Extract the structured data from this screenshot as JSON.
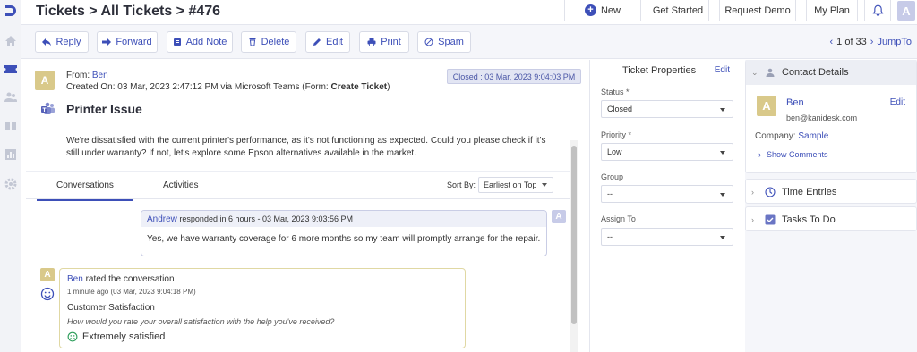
{
  "header": {
    "breadcrumb": "Tickets > All Tickets > #476",
    "new_label": "New",
    "get_started_label": "Get Started",
    "request_demo_label": "Request Demo",
    "my_plan_label": "My Plan",
    "user_initial": "A"
  },
  "toolbar": {
    "reply": "Reply",
    "forward": "Forward",
    "add_note": "Add Note",
    "delete": "Delete",
    "edit": "Edit",
    "print": "Print",
    "spam": "Spam",
    "pager_text": "1 of 33",
    "jump_to": "JumpTo"
  },
  "ticket": {
    "requester_initial": "A",
    "from_label": "From:",
    "from_name": "Ben",
    "created_prefix": "Created On: 03 Mar, 2023 2:47:12 PM via Microsoft Teams (Form:",
    "created_form": "Create Ticket",
    "created_suffix": ")",
    "closed_status": "Closed : 03 Mar, 2023 9:04:03 PM",
    "subject": "Printer Issue",
    "description": "We're dissatisfied with the current printer's performance, as it's not functioning as expected. Could you please check if it's still under warranty? If not, let's explore some Epson alternatives available in the market."
  },
  "tabs": {
    "conversations": "Conversations",
    "activities": "Activities",
    "sort_by_label": "Sort By:",
    "sort_value": "Earliest on Top"
  },
  "reply": {
    "agent_name": "Andrew",
    "meta": "responded in 6 hours -  03 Mar, 2023 9:03:56 PM",
    "body": "Yes, we have warranty coverage for 6 more months so my team will promptly arrange for the repair.",
    "agent_initial": "A"
  },
  "rating": {
    "initial": "A",
    "name": "Ben",
    "action": "rated the conversation",
    "time": "1 minute ago (03 Mar, 2023 9:04:18 PM)",
    "survey_title": "Customer Satisfaction",
    "question": "How would you rate your overall satisfaction with the help you've received?",
    "answer": "Extremely satisfied"
  },
  "properties": {
    "title": "Ticket Properties",
    "edit": "Edit",
    "status_label": "Status *",
    "status_value": "Closed",
    "priority_label": "Priority *",
    "priority_value": "Low",
    "group_label": "Group",
    "group_value": "--",
    "assign_label": "Assign To",
    "assign_value": "--"
  },
  "contact": {
    "section_title": "Contact Details",
    "initial": "A",
    "name": "Ben",
    "email": "ben@kanidesk.com",
    "edit": "Edit",
    "company_label": "Company:",
    "company_value": "Sample",
    "show_comments": "Show Comments",
    "time_entries": "Time Entries",
    "tasks": "Tasks To Do"
  },
  "colors": {
    "accent": "#3d4fb8",
    "avatar_yellow": "#d9c98a",
    "avatar_lavender": "#c7cbe8"
  }
}
